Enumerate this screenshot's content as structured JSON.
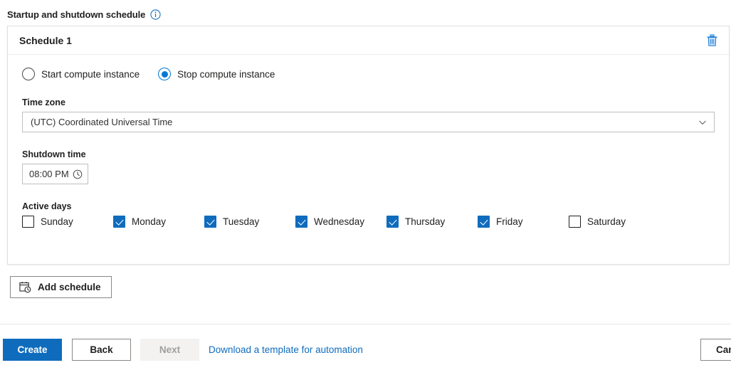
{
  "section": {
    "title": "Startup and shutdown schedule",
    "info_icon": "info-circle-icon"
  },
  "card": {
    "title": "Schedule 1",
    "delete_icon": "trash-icon",
    "action_options": [
      {
        "label": "Start compute instance",
        "selected": false
      },
      {
        "label": "Stop compute instance",
        "selected": true
      }
    ],
    "timezone": {
      "label": "Time zone",
      "value": "(UTC) Coordinated Universal Time",
      "chevron_icon": "chevron-down-icon"
    },
    "shutdown_time": {
      "label": "Shutdown time",
      "value": "08:00 PM",
      "clock_icon": "clock-icon"
    },
    "active_days": {
      "label": "Active days",
      "days": [
        {
          "label": "Sunday",
          "checked": false
        },
        {
          "label": "Monday",
          "checked": true
        },
        {
          "label": "Tuesday",
          "checked": true
        },
        {
          "label": "Wednesday",
          "checked": true
        },
        {
          "label": "Thursday",
          "checked": true
        },
        {
          "label": "Friday",
          "checked": true
        },
        {
          "label": "Saturday",
          "checked": false
        }
      ]
    }
  },
  "add_schedule": {
    "label": "Add schedule",
    "icon": "calendar-clock-icon"
  },
  "footer": {
    "create_label": "Create",
    "back_label": "Back",
    "next_label": "Next",
    "next_disabled": true,
    "template_link_label": "Download a template for automation",
    "cancel_label": "Cancel"
  },
  "colors": {
    "accent": "#0f6cbd",
    "radio_accent": "#0078d4",
    "link": "#0f6cbd",
    "disabled_text": "#a19f9d",
    "border": "#8a8886",
    "card_border": "#e1dfdd"
  }
}
